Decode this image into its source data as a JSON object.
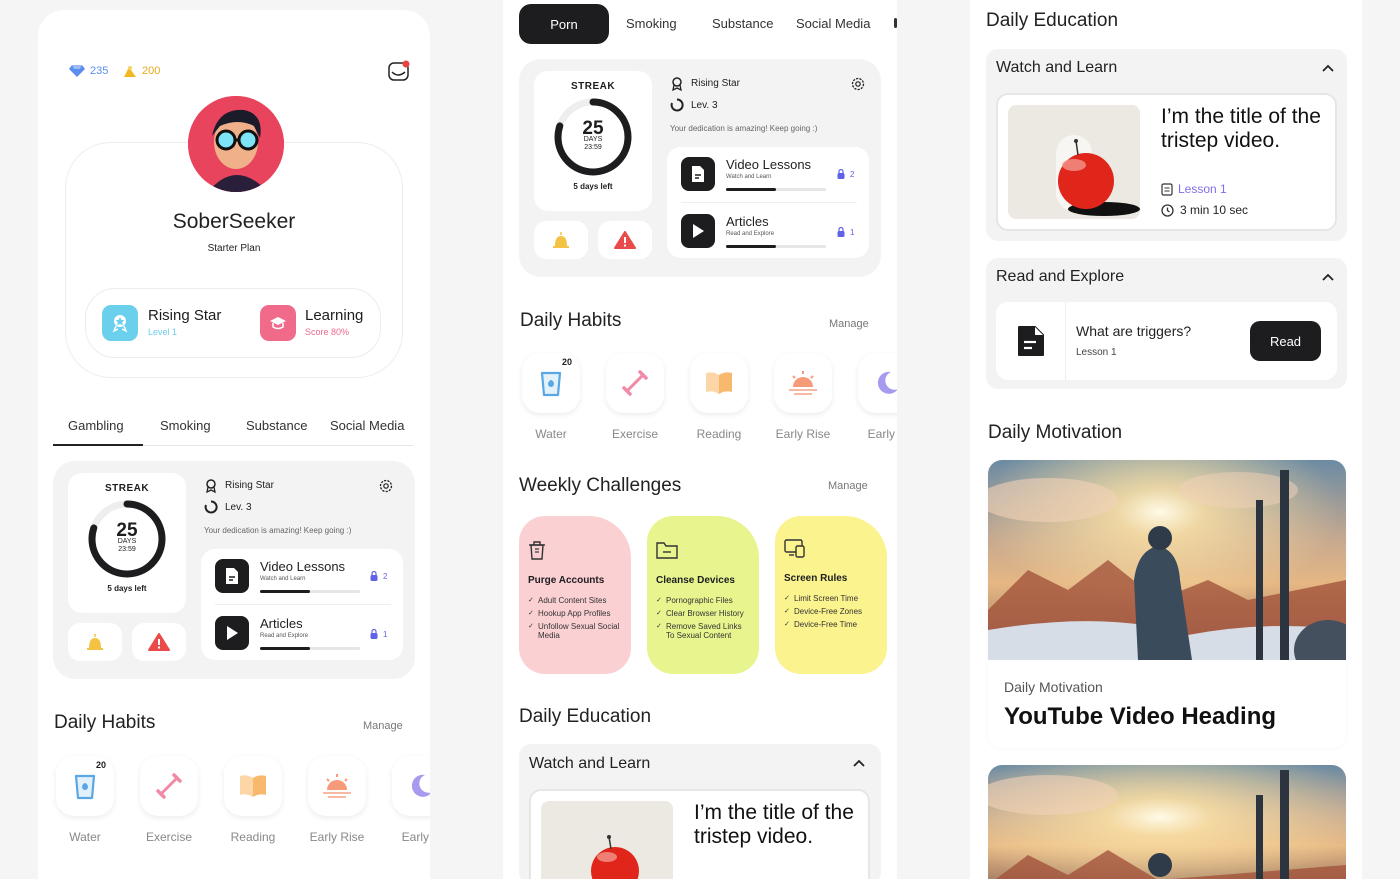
{
  "profile": {
    "gems": "235",
    "coins": "200",
    "username": "SoberSeeker",
    "plan": "Starter Plan",
    "rising_star": "Rising Star",
    "rising_level": "Level 1",
    "learning": "Learning",
    "learning_score": "Score 80%"
  },
  "colors": {
    "accent_blue": "#5b8def",
    "coin_yellow": "#f2b824",
    "pink": "#f06a8a",
    "cyan": "#6ad0ec",
    "challenge_pink": "#fbd0d3",
    "challenge_green": "#e8f58e",
    "challenge_yellow": "#fbf38e",
    "lesson_purple": "#7f6fe8"
  },
  "col1": {
    "tabs": [
      "Gambling",
      "Smoking",
      "Substance",
      "Social Media"
    ],
    "streak": {
      "label": "STREAK",
      "days": "25",
      "days_unit": "DAYS",
      "time": "23:59",
      "left": "5 days left",
      "progress": 0.8
    },
    "rank": "Rising Star",
    "level": "Lev. 3",
    "encouragement": "Your dedication is amazing! Keep going :)",
    "lessons": [
      {
        "title": "Video Lessons",
        "sub": "Watch and Learn",
        "count": "2",
        "progress": 0.5
      },
      {
        "title": "Articles",
        "sub": "Read and Explore",
        "count": "1",
        "progress": 0.5
      }
    ],
    "habits_title": "Daily Habits",
    "manage": "Manage",
    "habits": [
      {
        "label": "Water",
        "badge": "20"
      },
      {
        "label": "Exercise"
      },
      {
        "label": "Reading"
      },
      {
        "label": "Early Rise"
      },
      {
        "label": "Early E"
      }
    ]
  },
  "col2": {
    "tabs": [
      "Porn",
      "Smoking",
      "Substance",
      "Social Media"
    ],
    "streak": {
      "label": "STREAK",
      "days": "25",
      "days_unit": "DAYS",
      "time": "23:59",
      "left": "5 days left",
      "progress": 0.8
    },
    "rank": "Rising Star",
    "level": "Lev. 3",
    "encouragement": "Your dedication is amazing! Keep going :)",
    "lessons": [
      {
        "title": "Video Lessons",
        "sub": "Watch and Learn",
        "count": "2",
        "progress": 0.5
      },
      {
        "title": "Articles",
        "sub": "Read and Explore",
        "count": "1",
        "progress": 0.5
      }
    ],
    "habits_title": "Daily Habits",
    "manage": "Manage",
    "habits": [
      {
        "label": "Water",
        "badge": "20"
      },
      {
        "label": "Exercise"
      },
      {
        "label": "Reading"
      },
      {
        "label": "Early Rise"
      },
      {
        "label": "Early E"
      }
    ],
    "challenges_title": "Weekly Challenges",
    "challenges_manage": "Manage",
    "challenges": [
      {
        "title": "Purge Accounts",
        "items": [
          "Adult Content Sites",
          "Hookup App Profiles",
          "Unfollow Sexual Social Media"
        ]
      },
      {
        "title": "Cleanse Devices",
        "items": [
          "Pornographic Files",
          "Clear Browser History",
          "Remove Saved Links To Sexual Content"
        ]
      },
      {
        "title": "Screen Rules",
        "items": [
          "Limit Screen Time",
          "Device-Free Zones",
          "Device-Free Time"
        ]
      }
    ],
    "education_title": "Daily Education",
    "watch_learn": "Watch and Learn",
    "video_title": "I’m the title of the tristep video."
  },
  "col3": {
    "education_title": "Daily Education",
    "watch_learn": "Watch and Learn",
    "video_title": "I’m the title of the tristep video.",
    "lesson": "Lesson 1",
    "duration": "3 min 10 sec",
    "read_explore": "Read and Explore",
    "article_title": "What are triggers?",
    "article_lesson": "Lesson 1",
    "read_button": "Read",
    "motivation_title": "Daily Motivation",
    "motivation_sub": "Daily Motivation",
    "motivation_heading": "YouTube Video Heading"
  }
}
